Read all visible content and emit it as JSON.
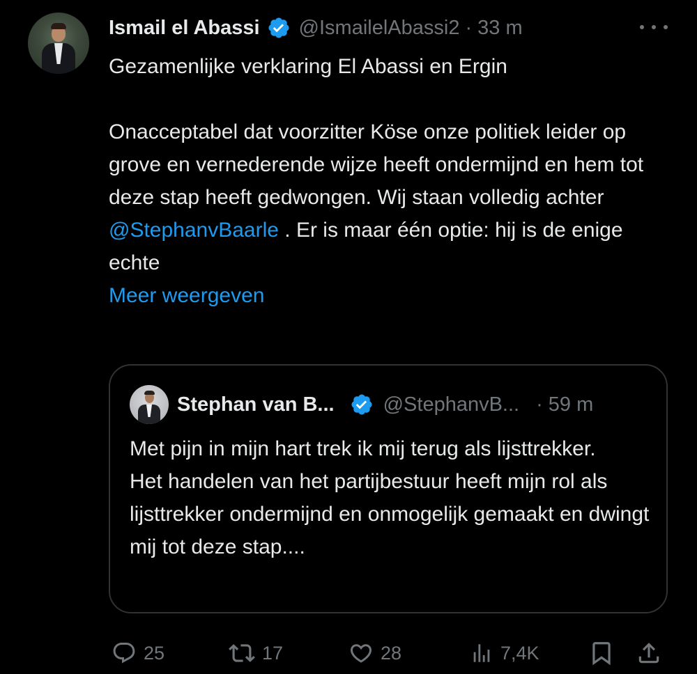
{
  "tweet": {
    "author_name": "Ismail el Abassi",
    "author_handle": "@IsmailelAbassi2",
    "separator": "·",
    "time": "33 m",
    "text_line1": "Gezamenlijke verklaring El Abassi en Ergin",
    "text_para2_before_mention": "Onacceptabel dat voorzitter Köse onze politiek leider op grove en vernederende wijze heeft ondermijnd en hem tot deze stap heeft gedwongen. Wij staan volledig achter ",
    "mention": "@StephanvBaarle",
    "text_para2_after_mention": " . Er is maar één optie: hij is de enige echte",
    "show_more": "Meer weergeven"
  },
  "quoted_tweet": {
    "author_name": "Stephan van B...",
    "author_handle": "@StephanvB...",
    "separator": "·",
    "time": "59 m",
    "text_line1": "Met pijn in mijn hart trek ik mij terug als lijsttrekker.",
    "text_line2": "Het handelen van het partijbestuur heeft mijn rol als lijsttrekker ondermijnd en onmogelijk gemaakt en dwingt mij tot deze stap...."
  },
  "actions": {
    "replies": "25",
    "reposts": "17",
    "likes": "28",
    "views": "7,4K"
  },
  "colors": {
    "background": "#000000",
    "text": "#e7e9ea",
    "secondary": "#71767b",
    "link": "#1d9bf0",
    "border": "#2f3336"
  },
  "icons": [
    "avatar",
    "verified-badge-icon",
    "more-icon",
    "reply-icon",
    "repost-icon",
    "like-icon",
    "views-icon",
    "bookmark-icon",
    "share-icon"
  ]
}
